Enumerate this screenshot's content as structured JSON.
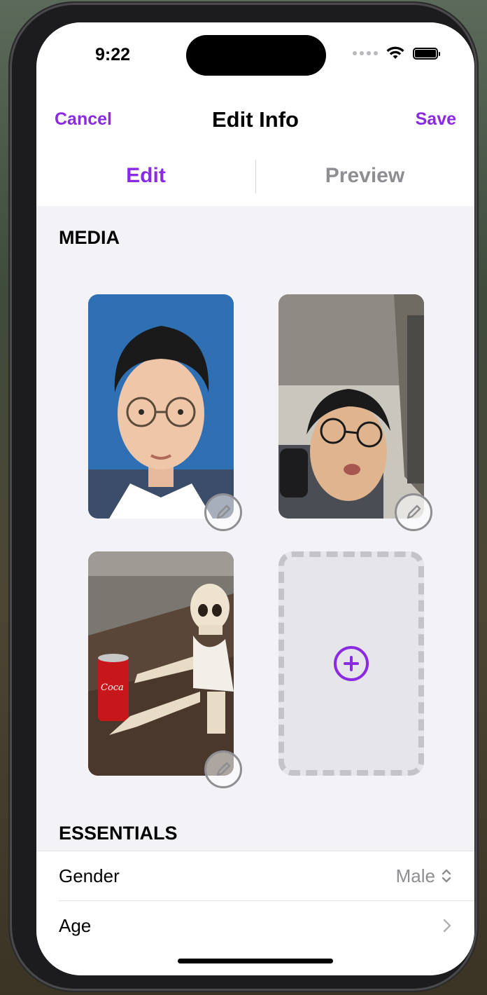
{
  "status_bar": {
    "time": "9:22"
  },
  "nav": {
    "cancel": "Cancel",
    "title": "Edit Info",
    "save": "Save"
  },
  "tabs": [
    {
      "label": "Edit",
      "active": true
    },
    {
      "label": "Preview",
      "active": false
    }
  ],
  "sections": {
    "media": "MEDIA",
    "essentials": "ESSENTIALS"
  },
  "media": {
    "photos": [
      {
        "icon": "pencil-icon"
      },
      {
        "icon": "pencil-icon"
      },
      {
        "icon": "pencil-icon"
      }
    ],
    "add_icon": "plus-circle-icon"
  },
  "essentials": {
    "rows": [
      {
        "label": "Gender",
        "value": "Male",
        "icon": "chevron-up-down-icon"
      },
      {
        "label": "Age",
        "value": "",
        "icon": "chevron-right-icon"
      }
    ]
  },
  "colors": {
    "accent": "#8a2be2",
    "secondary": "#8e8e93",
    "background": "#f2f2f7"
  }
}
